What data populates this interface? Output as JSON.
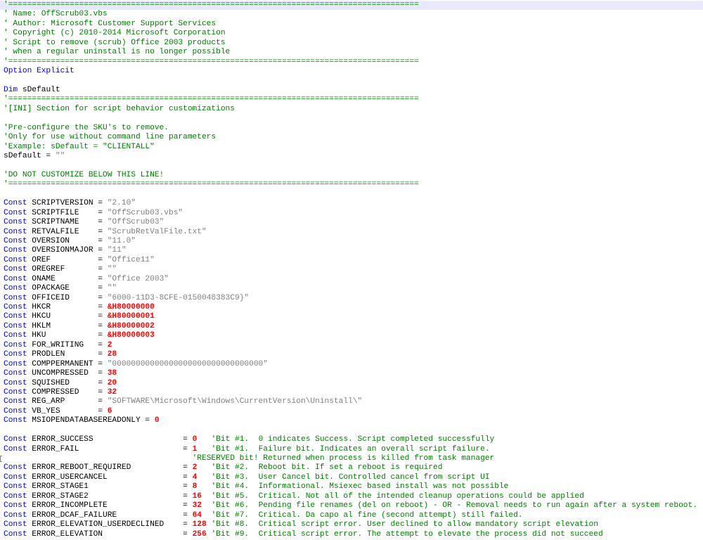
{
  "editor": {
    "lines": [
      [
        {
          "t": "comment",
          "v": "'======================================================================================="
        }
      ],
      [
        {
          "t": "comment",
          "v": "' Name: OffScrub03.vbs"
        }
      ],
      [
        {
          "t": "comment",
          "v": "' Author: Microsoft Customer Support Services"
        }
      ],
      [
        {
          "t": "comment",
          "v": "' Copyright (c) 2010-2014 Microsoft Corporation"
        }
      ],
      [
        {
          "t": "comment",
          "v": "' Script to remove (scrub) Office 2003 products"
        }
      ],
      [
        {
          "t": "comment",
          "v": "' when a regular uninstall is no longer possible"
        }
      ],
      [
        {
          "t": "comment",
          "v": "'======================================================================================="
        }
      ],
      [
        {
          "t": "keyword",
          "v": "Option Explicit"
        }
      ],
      [],
      [
        {
          "t": "keyword",
          "v": "Dim"
        },
        {
          "t": "plain",
          "v": " sDefault"
        }
      ],
      [
        {
          "t": "comment",
          "v": "'======================================================================================="
        }
      ],
      [
        {
          "t": "comment",
          "v": "'[INI] Section for script behavior customizations"
        }
      ],
      [],
      [
        {
          "t": "comment",
          "v": "'Pre-configure the SKU's to remove."
        }
      ],
      [
        {
          "t": "comment",
          "v": "'Only for use without command line parameters"
        }
      ],
      [
        {
          "t": "comment",
          "v": "'Example: sDefault = \"CLIENTALL\""
        }
      ],
      [
        {
          "t": "plain",
          "v": "sDefault = "
        },
        {
          "t": "string",
          "v": "\"\""
        }
      ],
      [],
      [
        {
          "t": "comment",
          "v": "'DO NOT CUSTOMIZE BELOW THIS LINE!"
        }
      ],
      [
        {
          "t": "comment",
          "v": "'======================================================================================="
        }
      ],
      [],
      [
        {
          "t": "keyword",
          "v": "Const"
        },
        {
          "t": "plain",
          "v": " SCRIPTVERSION = "
        },
        {
          "t": "string",
          "v": "\"2.10\""
        }
      ],
      [
        {
          "t": "keyword",
          "v": "Const"
        },
        {
          "t": "plain",
          "v": " SCRIPTFILE    = "
        },
        {
          "t": "string",
          "v": "\"OffScrub03.vbs\""
        }
      ],
      [
        {
          "t": "keyword",
          "v": "Const"
        },
        {
          "t": "plain",
          "v": " SCRIPTNAME    = "
        },
        {
          "t": "string",
          "v": "\"OffScrub03\""
        }
      ],
      [
        {
          "t": "keyword",
          "v": "Const"
        },
        {
          "t": "plain",
          "v": " RETVALFILE    = "
        },
        {
          "t": "string",
          "v": "\"ScrubRetValFile.txt\""
        }
      ],
      [
        {
          "t": "keyword",
          "v": "Const"
        },
        {
          "t": "plain",
          "v": " OVERSION      = "
        },
        {
          "t": "string",
          "v": "\"11.0\""
        }
      ],
      [
        {
          "t": "keyword",
          "v": "Const"
        },
        {
          "t": "plain",
          "v": " OVERSIONMAJOR = "
        },
        {
          "t": "string",
          "v": "\"11\""
        }
      ],
      [
        {
          "t": "keyword",
          "v": "Const"
        },
        {
          "t": "plain",
          "v": " OREF          = "
        },
        {
          "t": "string",
          "v": "\"Office11\""
        }
      ],
      [
        {
          "t": "keyword",
          "v": "Const"
        },
        {
          "t": "plain",
          "v": " OREGREF       = "
        },
        {
          "t": "string",
          "v": "\"\""
        }
      ],
      [
        {
          "t": "keyword",
          "v": "Const"
        },
        {
          "t": "plain",
          "v": " ONAME         = "
        },
        {
          "t": "string",
          "v": "\"Office 2003\""
        }
      ],
      [
        {
          "t": "keyword",
          "v": "Const"
        },
        {
          "t": "plain",
          "v": " OPACKAGE      = "
        },
        {
          "t": "string",
          "v": "\"\""
        }
      ],
      [
        {
          "t": "keyword",
          "v": "Const"
        },
        {
          "t": "plain",
          "v": " OFFICEID      = "
        },
        {
          "t": "string",
          "v": "\"6000-11D3-8CFE-0150048383C9}\""
        }
      ],
      [
        {
          "t": "keyword",
          "v": "Const"
        },
        {
          "t": "plain",
          "v": " HKCR          = "
        },
        {
          "t": "number",
          "v": "&H80000000"
        }
      ],
      [
        {
          "t": "keyword",
          "v": "Const"
        },
        {
          "t": "plain",
          "v": " HKCU          = "
        },
        {
          "t": "number",
          "v": "&H80000001"
        }
      ],
      [
        {
          "t": "keyword",
          "v": "Const"
        },
        {
          "t": "plain",
          "v": " HKLM          = "
        },
        {
          "t": "number",
          "v": "&H80000002"
        }
      ],
      [
        {
          "t": "keyword",
          "v": "Const"
        },
        {
          "t": "plain",
          "v": " HKU           = "
        },
        {
          "t": "number",
          "v": "&H80000003"
        }
      ],
      [
        {
          "t": "keyword",
          "v": "Const"
        },
        {
          "t": "plain",
          "v": " FOR_WRITING   = "
        },
        {
          "t": "number",
          "v": "2"
        }
      ],
      [
        {
          "t": "keyword",
          "v": "Const"
        },
        {
          "t": "plain",
          "v": " PRODLEN       = "
        },
        {
          "t": "number",
          "v": "28"
        }
      ],
      [
        {
          "t": "keyword",
          "v": "Const"
        },
        {
          "t": "plain",
          "v": " COMPPERMANENT = "
        },
        {
          "t": "string",
          "v": "\"00000000000000000000000000000000\""
        }
      ],
      [
        {
          "t": "keyword",
          "v": "Const"
        },
        {
          "t": "plain",
          "v": " UNCOMPRESSED  = "
        },
        {
          "t": "number",
          "v": "38"
        }
      ],
      [
        {
          "t": "keyword",
          "v": "Const"
        },
        {
          "t": "plain",
          "v": " SQUISHED      = "
        },
        {
          "t": "number",
          "v": "20"
        }
      ],
      [
        {
          "t": "keyword",
          "v": "Const"
        },
        {
          "t": "plain",
          "v": " COMPRESSED    = "
        },
        {
          "t": "number",
          "v": "32"
        }
      ],
      [
        {
          "t": "keyword",
          "v": "Const"
        },
        {
          "t": "plain",
          "v": " REG_ARP       = "
        },
        {
          "t": "string",
          "v": "\"SOFTWARE\\Microsoft\\Windows\\CurrentVersion\\Uninstall\\\""
        }
      ],
      [
        {
          "t": "keyword",
          "v": "Const"
        },
        {
          "t": "plain",
          "v": " VB_YES        = "
        },
        {
          "t": "number",
          "v": "6"
        }
      ],
      [
        {
          "t": "keyword",
          "v": "Const"
        },
        {
          "t": "plain",
          "v": " MSIOPENDATABASEREADONLY = "
        },
        {
          "t": "number",
          "v": "0"
        }
      ],
      [],
      [
        {
          "t": "keyword",
          "v": "Const"
        },
        {
          "t": "plain",
          "v": " ERROR_SUCCESS                   = "
        },
        {
          "t": "number",
          "v": "0"
        },
        {
          "t": "plain",
          "v": "   "
        },
        {
          "t": "comment",
          "v": "'Bit #1.  0 indicates Success. Script completed successfully"
        }
      ],
      [
        {
          "t": "keyword",
          "v": "Const"
        },
        {
          "t": "plain",
          "v": " ERROR_FAIL                      = "
        },
        {
          "t": "number",
          "v": "1"
        },
        {
          "t": "plain",
          "v": "   "
        },
        {
          "t": "comment",
          "v": "'Bit #1.  Failure bit. Indicates an overall script failure."
        }
      ],
      [
        {
          "t": "plain",
          "v": "                                        "
        },
        {
          "t": "comment",
          "v": "'RESERVED bit! Returned when process is killed from task manager"
        }
      ],
      [
        {
          "t": "keyword",
          "v": "Const"
        },
        {
          "t": "plain",
          "v": " ERROR_REBOOT_REQUIRED           = "
        },
        {
          "t": "number",
          "v": "2"
        },
        {
          "t": "plain",
          "v": "   "
        },
        {
          "t": "comment",
          "v": "'Bit #2.  Reboot bit. If set a reboot is required"
        }
      ],
      [
        {
          "t": "keyword",
          "v": "Const"
        },
        {
          "t": "plain",
          "v": " ERROR_USERCANCEL                = "
        },
        {
          "t": "number",
          "v": "4"
        },
        {
          "t": "plain",
          "v": "   "
        },
        {
          "t": "comment",
          "v": "'Bit #3.  User Cancel bit. Controlled cancel from script UI"
        }
      ],
      [
        {
          "t": "keyword",
          "v": "Const"
        },
        {
          "t": "plain",
          "v": " ERROR_STAGE1                    = "
        },
        {
          "t": "number",
          "v": "8"
        },
        {
          "t": "plain",
          "v": "   "
        },
        {
          "t": "comment",
          "v": "'Bit #4.  Informational. Msiexec based install was not possible"
        }
      ],
      [
        {
          "t": "keyword",
          "v": "Const"
        },
        {
          "t": "plain",
          "v": " ERROR_STAGE2                    = "
        },
        {
          "t": "number",
          "v": "16"
        },
        {
          "t": "plain",
          "v": "  "
        },
        {
          "t": "comment",
          "v": "'Bit #5.  Critical. Not all of the intended cleanup operations could be applied"
        }
      ],
      [
        {
          "t": "keyword",
          "v": "Const"
        },
        {
          "t": "plain",
          "v": " ERROR_INCOMPLETE                = "
        },
        {
          "t": "number",
          "v": "32"
        },
        {
          "t": "plain",
          "v": "  "
        },
        {
          "t": "comment",
          "v": "'Bit #6.  Pending file renames (del on reboot) - OR - Removal needs to run again after a system reboot."
        }
      ],
      [
        {
          "t": "keyword",
          "v": "Const"
        },
        {
          "t": "plain",
          "v": " ERROR_DCAF_FAILURE              = "
        },
        {
          "t": "number",
          "v": "64"
        },
        {
          "t": "plain",
          "v": "  "
        },
        {
          "t": "comment",
          "v": "'Bit #7.  Critical. Da capo al fine (second attempt) still failed."
        }
      ],
      [
        {
          "t": "keyword",
          "v": "Const"
        },
        {
          "t": "plain",
          "v": " ERROR_ELEVATION_USERDECLINED    = "
        },
        {
          "t": "number",
          "v": "128"
        },
        {
          "t": "plain",
          "v": " "
        },
        {
          "t": "comment",
          "v": "'Bit #8.  Critical script error. User declined to allow mandatory script elevation"
        }
      ],
      [
        {
          "t": "keyword",
          "v": "Const"
        },
        {
          "t": "plain",
          "v": " ERROR_ELEVATION                 = "
        },
        {
          "t": "number",
          "v": "256"
        },
        {
          "t": "plain",
          "v": " "
        },
        {
          "t": "comment",
          "v": "'Bit #9.  Critical script error. The attempt to elevate the process did not succeed"
        }
      ]
    ]
  }
}
